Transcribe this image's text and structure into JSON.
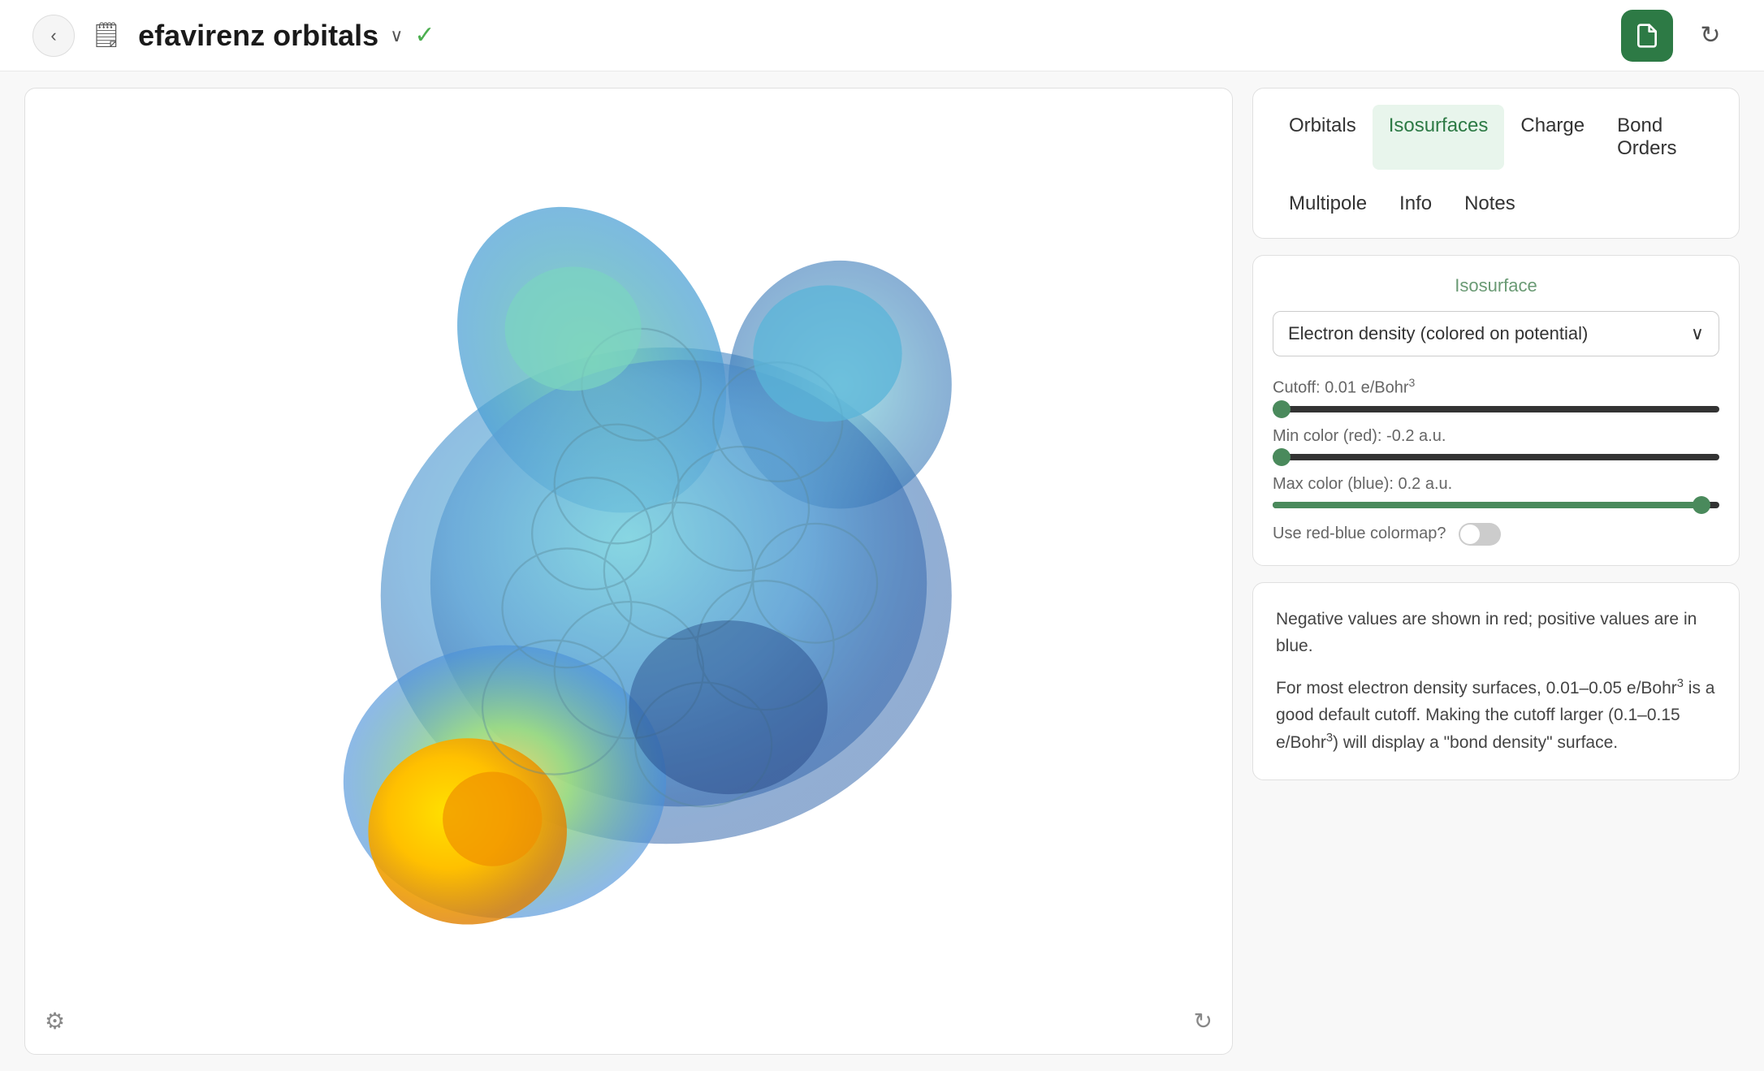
{
  "header": {
    "title": "efavirenz orbitals",
    "back_label": "‹",
    "doc_icon": "🗒",
    "chevron": "∨",
    "checkmark": "✓",
    "save_icon": "💾",
    "refresh_icon": "↻"
  },
  "tabs": {
    "row1": [
      {
        "id": "orbitals",
        "label": "Orbitals",
        "active": false
      },
      {
        "id": "isosurfaces",
        "label": "Isosurfaces",
        "active": true
      },
      {
        "id": "charge",
        "label": "Charge",
        "active": false
      },
      {
        "id": "bond-orders",
        "label": "Bond Orders",
        "active": false
      }
    ],
    "row2": [
      {
        "id": "multipole",
        "label": "Multipole",
        "active": false
      },
      {
        "id": "info",
        "label": "Info",
        "active": false
      },
      {
        "id": "notes",
        "label": "Notes",
        "active": false
      }
    ]
  },
  "isosurface": {
    "title": "Isosurface",
    "dropdown_value": "Electron density (colored on potential)",
    "dropdown_icon": "∨",
    "sliders": [
      {
        "id": "cutoff",
        "label": "Cutoff: 0.01 e/Bohr³",
        "fill_percent": 2,
        "thumb_percent": 2
      },
      {
        "id": "min-color",
        "label": "Min color (red): -0.2 a.u.",
        "fill_percent": 2,
        "thumb_percent": 2
      },
      {
        "id": "max-color",
        "label": "Max color (blue): 0.2 a.u.",
        "fill_percent": 96,
        "thumb_percent": 96
      }
    ],
    "toggle": {
      "label": "Use red-blue colormap?",
      "checked": false
    }
  },
  "info_text": {
    "paragraph1": "Negative values are shown in red; positive values are in blue.",
    "paragraph2": "For most electron density surfaces, 0.01–0.05 e/Bohr³ is a good default cutoff. Making the cutoff larger (0.1–0.15 e/Bohr³) will display a \"bond density\" surface."
  },
  "viewer": {
    "settings_icon": "⚙",
    "refresh_icon": "↻"
  }
}
